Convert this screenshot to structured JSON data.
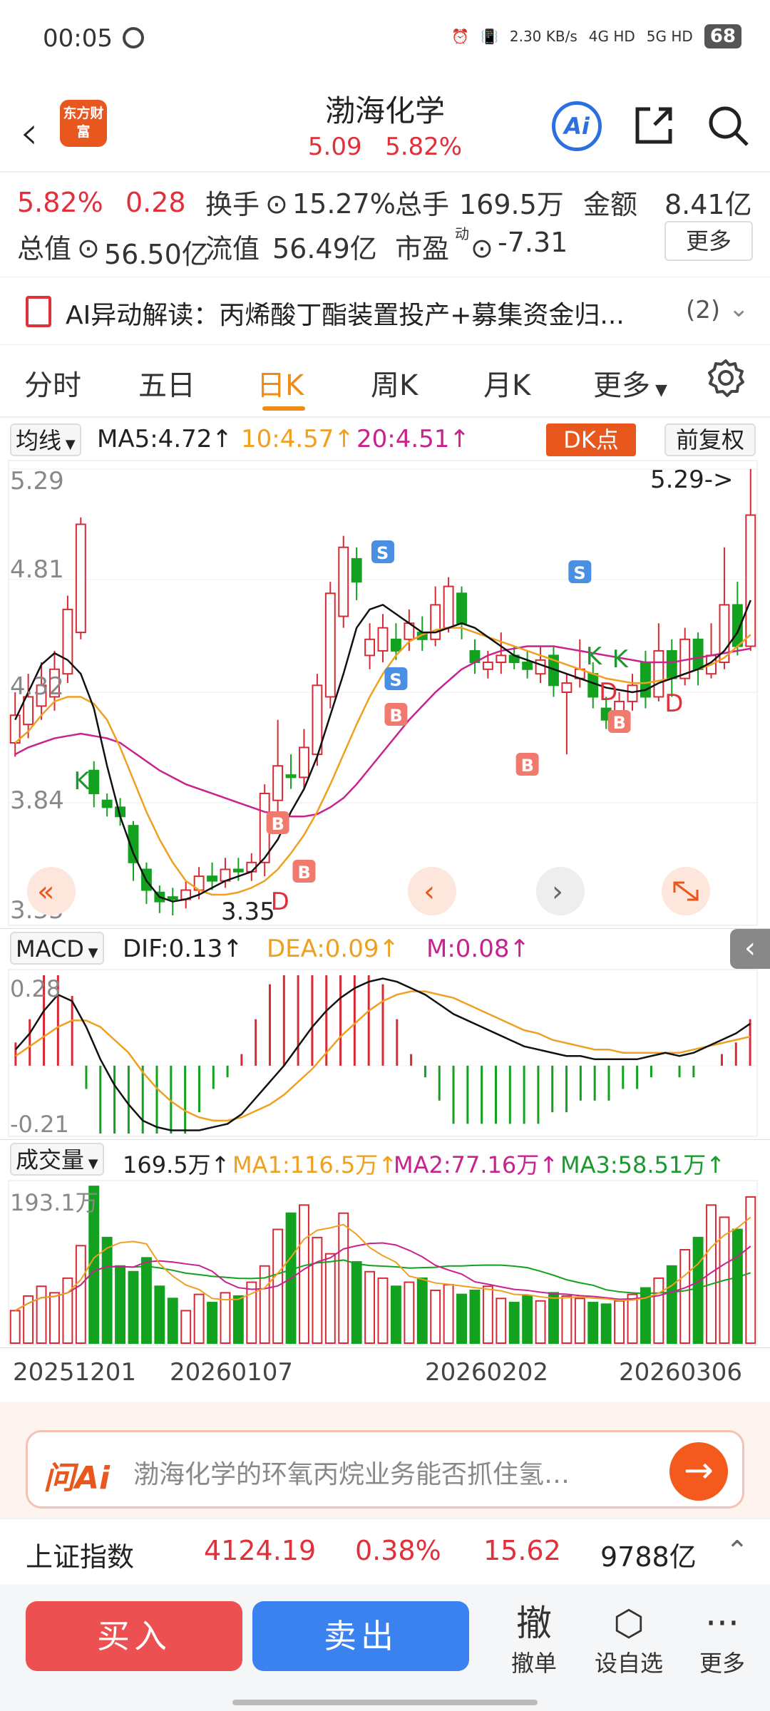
{
  "status_bar": {
    "time": "00:05",
    "net_speed": "2.30 KB/s",
    "sig1": "4G HD",
    "sig2": "5G HD",
    "battery": "68"
  },
  "header": {
    "logo_text": "东方财富",
    "stock_name": "渤海化学",
    "price": "5.09",
    "change_pct": "5.82%",
    "ai_label": "Ai"
  },
  "quote": {
    "pct": "5.82%",
    "chg": "0.28",
    "turnover_label": "换手",
    "turnover": "15.27%",
    "volume_label": "总手",
    "volume": "169.5万",
    "amount_label": "金额",
    "amount": "8.41亿",
    "mktcap_label": "总值",
    "mktcap": "56.50亿",
    "float_label": "流值",
    "float": "56.49亿",
    "pe_label": "市盈",
    "pe_sup": "动",
    "pe": "-7.31",
    "more": "更多"
  },
  "ai_banner": {
    "text": "AI异动解读：丙烯酸丁酯装置投产+募集资金归...",
    "count": "(2)"
  },
  "tabs": [
    "分时",
    "五日",
    "日K",
    "周K",
    "月K",
    "更多"
  ],
  "active_tab": "日K",
  "ma_row": {
    "selector": "均线",
    "ma5": "MA5:4.72↑",
    "ma10": "10:4.57↑",
    "ma20": "20:4.51↑",
    "dk": "DK点",
    "fuquan": "前复权"
  },
  "kchart": {
    "y_labels": [
      "5.29",
      "4.81",
      "4.32",
      "3.84",
      "3.35"
    ],
    "high_label": "5.29->",
    "low_label": "3.35",
    "signals": [
      {
        "t": "K",
        "color": "#1a9a2c"
      },
      {
        "t": "S",
        "color": "#4a90e2"
      },
      {
        "t": "S",
        "color": "#4a90e2"
      },
      {
        "t": "S",
        "color": "#4a90e2"
      },
      {
        "t": "B",
        "color": "#f07a6e"
      },
      {
        "t": "B",
        "color": "#f07a6e"
      },
      {
        "t": "B",
        "color": "#f07a6e"
      },
      {
        "t": "B",
        "color": "#f07a6e"
      },
      {
        "t": "B",
        "color": "#f07a6e"
      },
      {
        "t": "K",
        "color": "#1a9a2c"
      },
      {
        "t": "K",
        "color": "#1a9a2c"
      },
      {
        "t": "D",
        "color": "#e0303a"
      },
      {
        "t": "D",
        "color": "#e0303a"
      },
      {
        "t": "D",
        "color": "#e0303a"
      }
    ],
    "colors": {
      "up": "#d62b35",
      "down": "#12a21f",
      "ma5": "#111111",
      "ma10": "#f0a020",
      "ma20": "#c8228e"
    }
  },
  "macd_row": {
    "selector": "MACD",
    "dif": "DIF:0.13↑",
    "dea": "DEA:0.09↑",
    "m": "M:0.08↑",
    "y_top": "0.28",
    "y_bot": "-0.21"
  },
  "vol_row": {
    "selector": "成交量",
    "vol": "169.5万↑",
    "ma1": "MA1:116.5万↑",
    "ma2": "MA2:77.16万↑",
    "ma3": "MA3:58.51万↑",
    "y_top": "193.1万"
  },
  "x_dates": [
    "20251201",
    "20260107",
    "20260202",
    "20260306"
  ],
  "chart_data": {
    "type": "candlestick",
    "series": [
      {
        "o": 4.1,
        "c": 4.22,
        "h": 4.32,
        "l": 4.04
      },
      {
        "o": 4.18,
        "c": 4.3,
        "h": 4.4,
        "l": 4.12
      },
      {
        "o": 4.26,
        "c": 4.35,
        "h": 4.45,
        "l": 4.2
      },
      {
        "o": 4.3,
        "c": 4.42,
        "h": 4.5,
        "l": 4.24
      },
      {
        "o": 4.4,
        "c": 4.68,
        "h": 4.74,
        "l": 4.36
      },
      {
        "o": 4.58,
        "c": 5.05,
        "h": 5.08,
        "l": 4.55
      },
      {
        "o": 3.98,
        "c": 3.88,
        "h": 4.02,
        "l": 3.82
      },
      {
        "o": 3.85,
        "c": 3.82,
        "h": 3.88,
        "l": 3.78
      },
      {
        "o": 3.82,
        "c": 3.78,
        "h": 3.86,
        "l": 3.74
      },
      {
        "o": 3.74,
        "c": 3.58,
        "h": 3.76,
        "l": 3.5
      },
      {
        "o": 3.55,
        "c": 3.46,
        "h": 3.58,
        "l": 3.4
      },
      {
        "o": 3.45,
        "c": 3.41,
        "h": 3.48,
        "l": 3.36
      },
      {
        "o": 3.43,
        "c": 3.42,
        "h": 3.47,
        "l": 3.35
      },
      {
        "o": 3.42,
        "c": 3.46,
        "h": 3.5,
        "l": 3.38
      },
      {
        "o": 3.46,
        "c": 3.52,
        "h": 3.56,
        "l": 3.42
      },
      {
        "o": 3.52,
        "c": 3.5,
        "h": 3.58,
        "l": 3.46
      },
      {
        "o": 3.5,
        "c": 3.55,
        "h": 3.6,
        "l": 3.47
      },
      {
        "o": 3.55,
        "c": 3.54,
        "h": 3.6,
        "l": 3.5
      },
      {
        "o": 3.54,
        "c": 3.58,
        "h": 3.62,
        "l": 3.5
      },
      {
        "o": 3.58,
        "c": 3.88,
        "h": 3.92,
        "l": 3.52
      },
      {
        "o": 3.85,
        "c": 4.0,
        "h": 4.2,
        "l": 3.8
      },
      {
        "o": 3.96,
        "c": 3.95,
        "h": 4.05,
        "l": 3.9
      },
      {
        "o": 3.95,
        "c": 4.08,
        "h": 4.16,
        "l": 3.9
      },
      {
        "o": 4.05,
        "c": 4.35,
        "h": 4.4,
        "l": 4.0
      },
      {
        "o": 4.3,
        "c": 4.75,
        "h": 4.8,
        "l": 4.25
      },
      {
        "o": 4.65,
        "c": 4.95,
        "h": 5.0,
        "l": 4.6
      },
      {
        "o": 4.9,
        "c": 4.8,
        "h": 4.95,
        "l": 4.72
      },
      {
        "o": 4.48,
        "c": 4.55,
        "h": 4.62,
        "l": 4.42
      },
      {
        "o": 4.5,
        "c": 4.6,
        "h": 4.66,
        "l": 4.45
      },
      {
        "o": 4.55,
        "c": 4.5,
        "h": 4.62,
        "l": 4.46
      },
      {
        "o": 4.55,
        "c": 4.62,
        "h": 4.68,
        "l": 4.5
      },
      {
        "o": 4.58,
        "c": 4.55,
        "h": 4.65,
        "l": 4.5
      },
      {
        "o": 4.55,
        "c": 4.7,
        "h": 4.78,
        "l": 4.52
      },
      {
        "o": 4.6,
        "c": 4.78,
        "h": 4.82,
        "l": 4.58
      },
      {
        "o": 4.75,
        "c": 4.62,
        "h": 4.78,
        "l": 4.55
      },
      {
        "o": 4.5,
        "c": 4.45,
        "h": 4.55,
        "l": 4.4
      },
      {
        "o": 4.42,
        "c": 4.45,
        "h": 4.5,
        "l": 4.38
      },
      {
        "o": 4.45,
        "c": 4.48,
        "h": 4.58,
        "l": 4.4
      },
      {
        "o": 4.48,
        "c": 4.45,
        "h": 4.52,
        "l": 4.42
      },
      {
        "o": 4.45,
        "c": 4.42,
        "h": 4.5,
        "l": 4.38
      },
      {
        "o": 4.4,
        "c": 4.46,
        "h": 4.52,
        "l": 4.36
      },
      {
        "o": 4.48,
        "c": 4.35,
        "h": 4.52,
        "l": 4.3
      },
      {
        "o": 4.32,
        "c": 4.36,
        "h": 4.4,
        "l": 4.05
      },
      {
        "o": 4.38,
        "c": 4.42,
        "h": 4.55,
        "l": 4.34
      },
      {
        "o": 4.4,
        "c": 4.3,
        "h": 4.45,
        "l": 4.25
      },
      {
        "o": 4.25,
        "c": 4.2,
        "h": 4.3,
        "l": 4.16
      },
      {
        "o": 4.22,
        "c": 4.28,
        "h": 4.32,
        "l": 4.18
      },
      {
        "o": 4.28,
        "c": 4.35,
        "h": 4.4,
        "l": 4.24
      },
      {
        "o": 4.45,
        "c": 4.3,
        "h": 4.5,
        "l": 4.25
      },
      {
        "o": 4.3,
        "c": 4.5,
        "h": 4.62,
        "l": 4.28
      },
      {
        "o": 4.5,
        "c": 4.38,
        "h": 4.55,
        "l": 4.3
      },
      {
        "o": 4.38,
        "c": 4.55,
        "h": 4.6,
        "l": 4.35
      },
      {
        "o": 4.55,
        "c": 4.42,
        "h": 4.58,
        "l": 4.35
      },
      {
        "o": 4.4,
        "c": 4.48,
        "h": 4.62,
        "l": 4.38
      },
      {
        "o": 4.45,
        "c": 4.7,
        "h": 4.95,
        "l": 4.42
      },
      {
        "o": 4.7,
        "c": 4.52,
        "h": 4.8,
        "l": 4.48
      },
      {
        "o": 4.52,
        "c": 5.09,
        "h": 5.29,
        "l": 4.5
      }
    ],
    "ma5": [
      4.2,
      4.32,
      4.44,
      4.49,
      4.46,
      4.4,
      4.25,
      4.0,
      3.78,
      3.62,
      3.5,
      3.43,
      3.41,
      3.42,
      3.44,
      3.47,
      3.5,
      3.52,
      3.54,
      3.6,
      3.68,
      3.8,
      3.9,
      4.04,
      4.22,
      4.4,
      4.6,
      4.68,
      4.7,
      4.66,
      4.62,
      4.58,
      4.58,
      4.6,
      4.62,
      4.6,
      4.56,
      4.52,
      4.48,
      4.46,
      4.44,
      4.42,
      4.4,
      4.38,
      4.36,
      4.34,
      4.33,
      4.32,
      4.33,
      4.36,
      4.38,
      4.4,
      4.42,
      4.45,
      4.5,
      4.58,
      4.72
    ],
    "ma10": [
      4.1,
      4.15,
      4.22,
      4.28,
      4.3,
      4.3,
      4.27,
      4.2,
      4.08,
      3.94,
      3.8,
      3.68,
      3.58,
      3.5,
      3.46,
      3.44,
      3.44,
      3.45,
      3.47,
      3.5,
      3.55,
      3.62,
      3.7,
      3.8,
      3.92,
      4.05,
      4.18,
      4.3,
      4.4,
      4.48,
      4.54,
      4.57,
      4.59,
      4.6,
      4.6,
      4.58,
      4.56,
      4.54,
      4.52,
      4.5,
      4.48,
      4.46,
      4.44,
      4.42,
      4.4,
      4.38,
      4.37,
      4.36,
      4.36,
      4.37,
      4.38,
      4.4,
      4.42,
      4.44,
      4.47,
      4.52,
      4.57
    ],
    "ma20": [
      4.05,
      4.08,
      4.1,
      4.12,
      4.13,
      4.14,
      4.13,
      4.12,
      4.1,
      4.06,
      4.02,
      3.98,
      3.95,
      3.92,
      3.9,
      3.88,
      3.86,
      3.84,
      3.82,
      3.8,
      3.79,
      3.78,
      3.78,
      3.79,
      3.82,
      3.86,
      3.92,
      3.99,
      4.06,
      4.13,
      4.2,
      4.26,
      4.32,
      4.37,
      4.42,
      4.45,
      4.48,
      4.5,
      4.51,
      4.52,
      4.52,
      4.52,
      4.51,
      4.5,
      4.49,
      4.48,
      4.47,
      4.46,
      4.45,
      4.45,
      4.45,
      4.46,
      4.47,
      4.48,
      4.49,
      4.5,
      4.51
    ],
    "macd": {
      "dif": [
        0.05,
        0.1,
        0.17,
        0.22,
        0.2,
        0.12,
        0.02,
        -0.06,
        -0.12,
        -0.17,
        -0.19,
        -0.2,
        -0.2,
        -0.2,
        -0.19,
        -0.18,
        -0.15,
        -0.1,
        -0.05,
        0.0,
        0.06,
        0.12,
        0.17,
        0.21,
        0.24,
        0.26,
        0.27,
        0.26,
        0.24,
        0.22,
        0.19,
        0.16,
        0.14,
        0.12,
        0.1,
        0.08,
        0.06,
        0.05,
        0.04,
        0.03,
        0.03,
        0.02,
        0.02,
        0.02,
        0.02,
        0.03,
        0.04,
        0.03,
        0.04,
        0.06,
        0.08,
        0.1,
        0.13
      ],
      "dea": [
        0.03,
        0.06,
        0.09,
        0.12,
        0.14,
        0.14,
        0.12,
        0.08,
        0.04,
        -0.02,
        -0.07,
        -0.11,
        -0.14,
        -0.16,
        -0.17,
        -0.17,
        -0.16,
        -0.14,
        -0.12,
        -0.09,
        -0.05,
        -0.01,
        0.04,
        0.09,
        0.13,
        0.17,
        0.2,
        0.22,
        0.23,
        0.23,
        0.22,
        0.21,
        0.19,
        0.17,
        0.15,
        0.13,
        0.11,
        0.1,
        0.08,
        0.07,
        0.06,
        0.05,
        0.05,
        0.04,
        0.04,
        0.04,
        0.04,
        0.04,
        0.05,
        0.06,
        0.07,
        0.08,
        0.09
      ],
      "ylim": [
        -0.21,
        0.28
      ]
    },
    "volume": [
      40,
      58,
      70,
      62,
      80,
      120,
      193,
      130,
      95,
      88,
      105,
      70,
      55,
      40,
      60,
      50,
      62,
      58,
      75,
      95,
      140,
      160,
      170,
      130,
      110,
      160,
      100,
      88,
      80,
      70,
      75,
      80,
      65,
      72,
      60,
      65,
      70,
      55,
      50,
      58,
      52,
      62,
      58,
      55,
      50,
      48,
      52,
      60,
      68,
      80,
      95,
      115,
      130,
      170,
      155,
      140,
      180
    ],
    "vol_ylim": [
      0,
      193.1
    ]
  },
  "ask_ai": {
    "label": "问Ai",
    "placeholder": "渤海化学的环氧丙烷业务能否抓住氢…"
  },
  "index_bar": {
    "name": "上证指数",
    "value": "4124.19",
    "pct": "0.38%",
    "chg": "15.62",
    "amount": "9788亿"
  },
  "bottom": {
    "buy": "买入",
    "sell": "卖出",
    "cancel_icon": "撤",
    "cancel": "撤单",
    "watch": "设自选",
    "more": "更多"
  }
}
